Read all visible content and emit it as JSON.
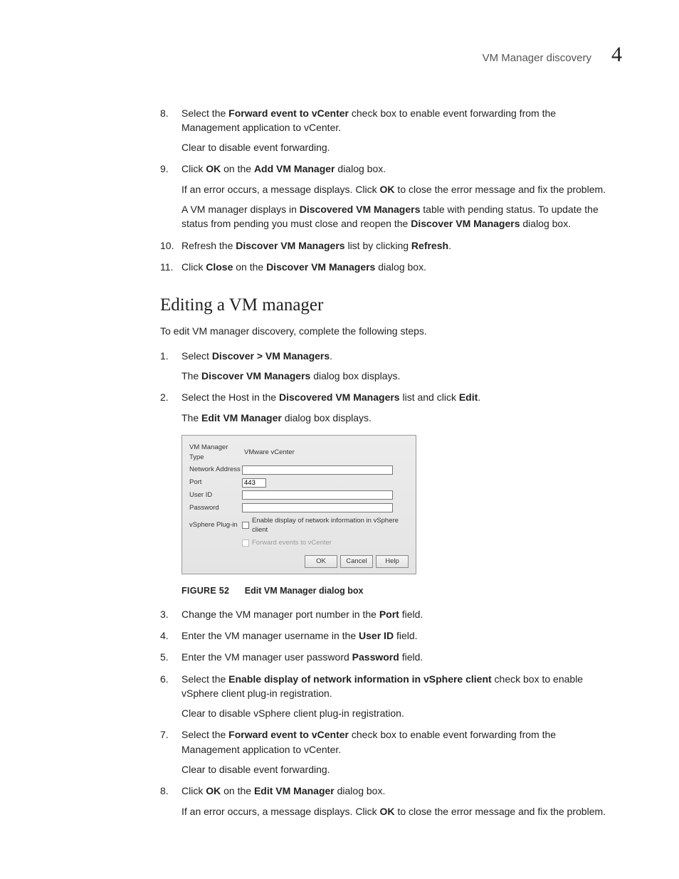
{
  "header": {
    "title": "VM Manager discovery",
    "number": "4"
  },
  "sectionA": [
    {
      "num": "8.",
      "parts": [
        {
          "t": "Select the "
        },
        {
          "t": "Forward event to vCenter",
          "b": true
        },
        {
          "t": " check box to enable event forwarding from the Management application to vCenter."
        }
      ],
      "paras": [
        [
          {
            "t": "Clear to disable event forwarding."
          }
        ]
      ]
    },
    {
      "num": "9.",
      "parts": [
        {
          "t": "Click "
        },
        {
          "t": "OK",
          "b": true
        },
        {
          "t": " on the "
        },
        {
          "t": "Add VM Manager",
          "b": true
        },
        {
          "t": " dialog box."
        }
      ],
      "paras": [
        [
          {
            "t": "If an error occurs, a message displays. Click "
          },
          {
            "t": "OK",
            "b": true
          },
          {
            "t": " to close the error message and fix the problem."
          }
        ],
        [
          {
            "t": "A VM manager displays in "
          },
          {
            "t": "Discovered VM Managers",
            "b": true
          },
          {
            "t": " table with pending status. To update the status from pending you must close and reopen the "
          },
          {
            "t": "Discover VM Managers",
            "b": true
          },
          {
            "t": " dialog box."
          }
        ]
      ]
    },
    {
      "num": "10.",
      "parts": [
        {
          "t": "Refresh the "
        },
        {
          "t": "Discover VM Managers",
          "b": true
        },
        {
          "t": " list by clicking "
        },
        {
          "t": "Refresh",
          "b": true
        },
        {
          "t": "."
        }
      ]
    },
    {
      "num": "11.",
      "parts": [
        {
          "t": "Click "
        },
        {
          "t": "Close",
          "b": true
        },
        {
          "t": " on the "
        },
        {
          "t": "Discover VM Managers",
          "b": true
        },
        {
          "t": " dialog box."
        }
      ]
    }
  ],
  "heading2": "Editing a VM manager",
  "intro": "To edit VM manager discovery, complete the following steps.",
  "sectionB_pre": [
    {
      "num": "1.",
      "parts": [
        {
          "t": "Select "
        },
        {
          "t": "Discover > VM Managers",
          "b": true
        },
        {
          "t": "."
        }
      ],
      "paras": [
        [
          {
            "t": "The "
          },
          {
            "t": "Discover VM Managers",
            "b": true
          },
          {
            "t": " dialog box displays."
          }
        ]
      ]
    },
    {
      "num": "2.",
      "parts": [
        {
          "t": "Select the Host in the "
        },
        {
          "t": "Discovered VM Managers",
          "b": true
        },
        {
          "t": " list and click "
        },
        {
          "t": "Edit",
          "b": true
        },
        {
          "t": "."
        }
      ],
      "paras": [
        [
          {
            "t": "The "
          },
          {
            "t": "Edit VM Manager",
            "b": true
          },
          {
            "t": " dialog box displays."
          }
        ]
      ]
    }
  ],
  "dialog": {
    "rows": {
      "type_label": "VM Manager Type",
      "type_value": "VMware vCenter",
      "addr_label": "Network Address",
      "addr_value": "",
      "port_label": "Port",
      "port_value": "443",
      "user_label": "User ID",
      "user_value": "",
      "pass_label": "Password",
      "pass_value": "",
      "plugin_label": "vSphere Plug-in",
      "plugin_cb_text": "Enable display of network information in vSphere client",
      "forward_cb_text": "Forward events to vCenter"
    },
    "buttons": {
      "ok": "OK",
      "cancel": "Cancel",
      "help": "Help"
    }
  },
  "figure": {
    "label": "FIGURE 52",
    "caption": "Edit VM Manager dialog box"
  },
  "sectionB_post": [
    {
      "num": "3.",
      "parts": [
        {
          "t": "Change the VM manager port number in the "
        },
        {
          "t": "Port",
          "b": true
        },
        {
          "t": " field."
        }
      ]
    },
    {
      "num": "4.",
      "parts": [
        {
          "t": "Enter the VM manager username in the "
        },
        {
          "t": "User ID",
          "b": true
        },
        {
          "t": " field."
        }
      ]
    },
    {
      "num": "5.",
      "parts": [
        {
          "t": "Enter the VM manager user password "
        },
        {
          "t": "Password",
          "b": true
        },
        {
          "t": " field."
        }
      ]
    },
    {
      "num": "6.",
      "parts": [
        {
          "t": "Select the "
        },
        {
          "t": "Enable display of network information in vSphere client",
          "b": true
        },
        {
          "t": " check box to enable vSphere client plug-in registration."
        }
      ],
      "paras": [
        [
          {
            "t": "Clear to disable vSphere client plug-in registration."
          }
        ]
      ]
    },
    {
      "num": "7.",
      "parts": [
        {
          "t": "Select the "
        },
        {
          "t": "Forward event to vCenter",
          "b": true
        },
        {
          "t": " check box to enable event forwarding from the Management application to vCenter."
        }
      ],
      "paras": [
        [
          {
            "t": "Clear to disable event forwarding."
          }
        ]
      ]
    },
    {
      "num": "8.",
      "parts": [
        {
          "t": "Click "
        },
        {
          "t": "OK",
          "b": true
        },
        {
          "t": " on the "
        },
        {
          "t": "Edit VM Manager",
          "b": true
        },
        {
          "t": " dialog box."
        }
      ],
      "paras": [
        [
          {
            "t": "If an error occurs, a message displays. Click "
          },
          {
            "t": "OK",
            "b": true
          },
          {
            "t": " to close the error message and fix the problem."
          }
        ]
      ]
    }
  ]
}
